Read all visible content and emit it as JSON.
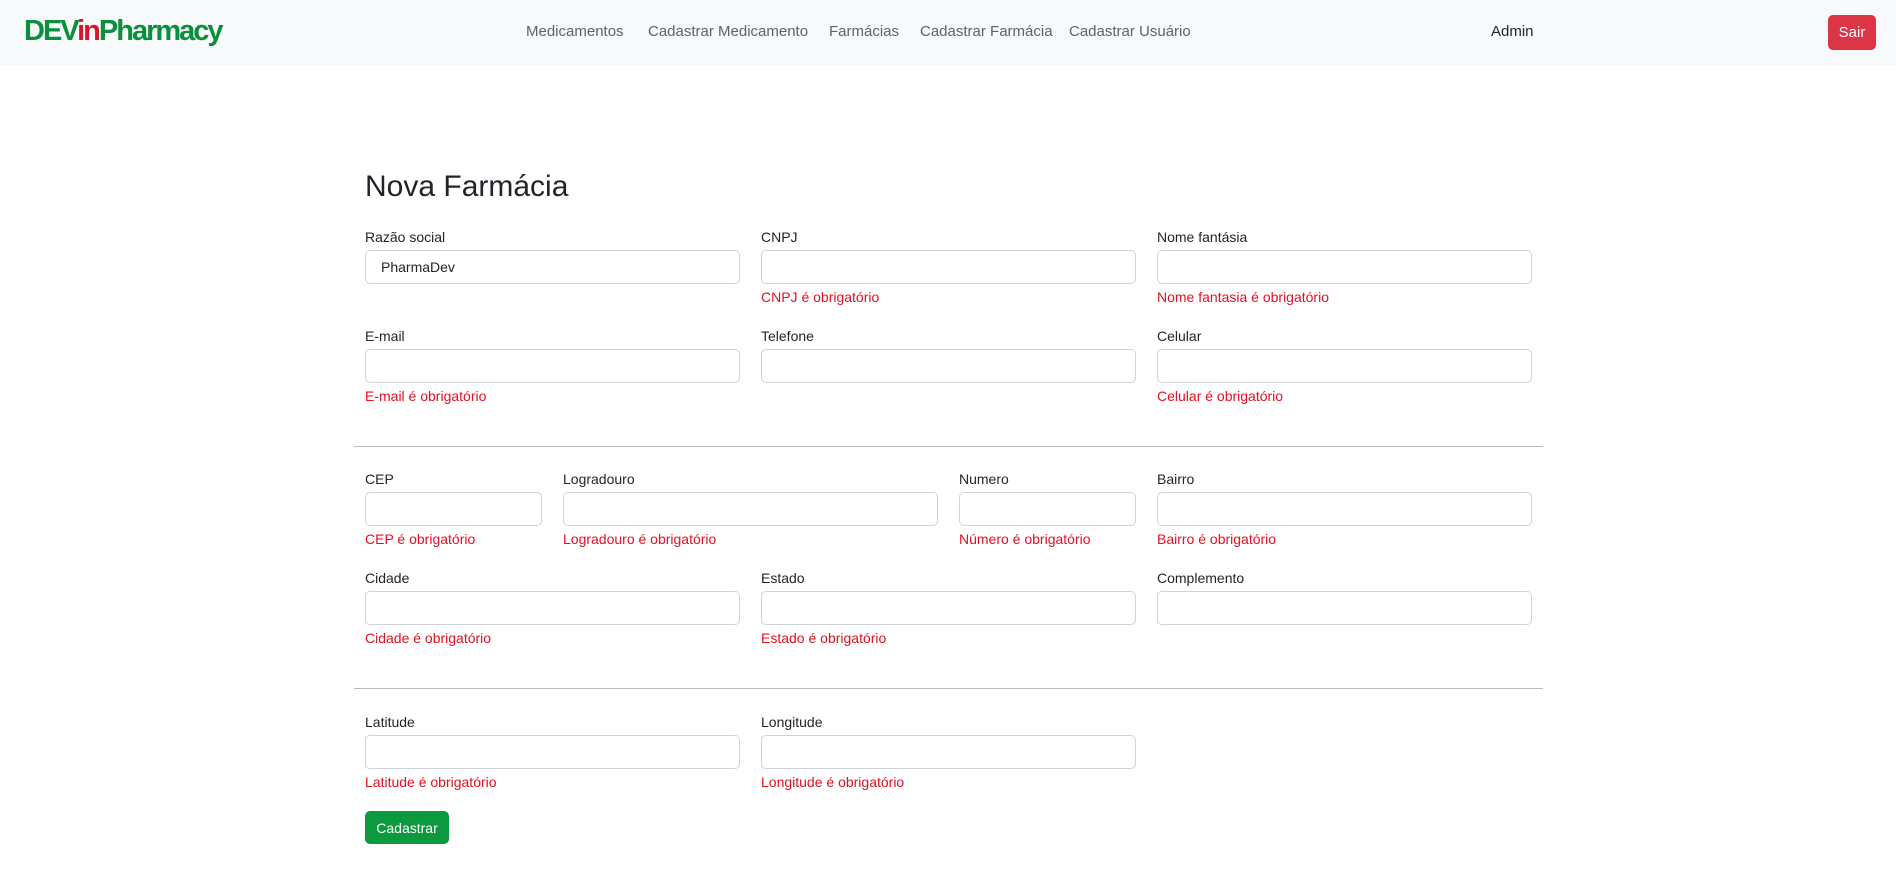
{
  "navbar": {
    "brand": {
      "dev": "DEV",
      "in": "in",
      "pharmacy": "Pharmacy"
    },
    "links": [
      "Medicamentos",
      "Cadastrar Medicamento",
      "Farmácias",
      "Cadastrar Farmácia",
      "Cadastrar Usuário"
    ],
    "user": "Admin",
    "logout_label": "Sair"
  },
  "form": {
    "title": "Nova Farmácia",
    "fields": {
      "razao_social": {
        "label": "Razão social",
        "value": "PharmaDev",
        "error": ""
      },
      "cnpj": {
        "label": "CNPJ",
        "value": "",
        "error": "CNPJ é obrigatório"
      },
      "nome_fantasia": {
        "label": "Nome fantásia",
        "value": "",
        "error": "Nome fantasia é obrigatório"
      },
      "email": {
        "label": "E-mail",
        "value": "",
        "error": "E-mail é obrigatório"
      },
      "telefone": {
        "label": "Telefone",
        "value": "",
        "error": ""
      },
      "celular": {
        "label": "Celular",
        "value": "",
        "error": "Celular é obrigatório"
      },
      "cep": {
        "label": "CEP",
        "value": "",
        "error": "CEP é obrigatório"
      },
      "logradouro": {
        "label": "Logradouro",
        "value": "",
        "error": "Logradouro é obrigatório"
      },
      "numero": {
        "label": "Numero",
        "value": "",
        "error": "Número é obrigatório"
      },
      "bairro": {
        "label": "Bairro",
        "value": "",
        "error": "Bairro é obrigatório"
      },
      "cidade": {
        "label": "Cidade",
        "value": "",
        "error": "Cidade é obrigatório"
      },
      "estado": {
        "label": "Estado",
        "value": "",
        "error": "Estado é obrigatório"
      },
      "complemento": {
        "label": "Complemento",
        "value": "",
        "error": ""
      },
      "latitude": {
        "label": "Latitude",
        "value": "",
        "error": "Latitude é obrigatório"
      },
      "longitude": {
        "label": "Longitude",
        "value": "",
        "error": "Longitude é obrigatório"
      }
    },
    "submit_label": "Cadastrar"
  },
  "colors": {
    "brand_green": "#0c8f3d",
    "brand_red": "#d3172d",
    "error_red": "#e3101f",
    "danger": "#dc3545",
    "success": "#0b9a3d"
  }
}
